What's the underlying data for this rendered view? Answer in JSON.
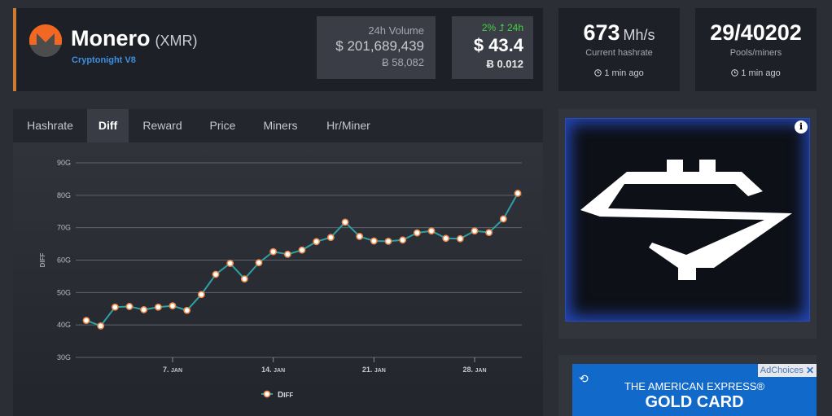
{
  "coin": {
    "name": "Monero",
    "ticker": "(XMR)",
    "algorithm": "Cryptonight V8",
    "accent_color": "#d07a31"
  },
  "volume": {
    "label": "24h Volume",
    "usd": "$ 201,689,439",
    "btc": "Ƀ 58,082"
  },
  "price": {
    "change": "2% ⮥ 24h",
    "change_color": "#41d241",
    "usd": "$ 43.4",
    "btc": "Ƀ 0.012"
  },
  "stats": [
    {
      "value": "673",
      "unit": "Mh/s",
      "label": "Current hashrate",
      "time": "1 min ago",
      "icon": "clock-icon"
    },
    {
      "value": "29/40202",
      "unit": "",
      "label": "Pools/miners",
      "time": "1 min ago",
      "icon": "clock-icon"
    }
  ],
  "tabs": [
    "Hashrate",
    "Diff",
    "Reward",
    "Price",
    "Miners",
    "Hr/Miner"
  ],
  "active_tab": "Diff",
  "chart_data": {
    "type": "line",
    "ylabel": "Diff",
    "xlabel": "",
    "ylim": [
      30,
      90
    ],
    "yticks": [
      "30G",
      "40G",
      "50G",
      "60G",
      "70G",
      "80G",
      "90G"
    ],
    "ytick_values": [
      30,
      40,
      50,
      60,
      70,
      80,
      90
    ],
    "x_tick_labels": [
      "7. Jan",
      "14. Jan",
      "21. Jan",
      "28. Jan"
    ],
    "x_tick_days": [
      7,
      14,
      21,
      28
    ],
    "x": [
      1,
      2,
      3,
      4,
      5,
      6,
      7,
      8,
      9,
      10,
      11,
      12,
      13,
      14,
      15,
      16,
      17,
      18,
      19,
      20,
      21,
      22,
      23,
      24,
      25,
      26,
      27,
      28,
      29,
      30,
      31
    ],
    "series": [
      {
        "name": "Diff",
        "values": [
          41.4,
          39.7,
          45.5,
          45.7,
          44.7,
          45.5,
          45.9,
          44.5,
          49.4,
          55.6,
          59.0,
          54.2,
          59.2,
          62.6,
          61.8,
          63.1,
          65.7,
          67.0,
          71.7,
          67.3,
          65.9,
          65.8,
          66.2,
          68.4,
          69.0,
          66.7,
          66.6,
          69.0,
          68.5,
          72.7,
          80.6
        ]
      }
    ],
    "line_color": "#2fa0a3",
    "marker_color": "#ee8a4b",
    "grid": true,
    "legend_position": "bottom-center"
  },
  "ad2": {
    "top_text": "THE AMERICAN EXPRESS®",
    "main_text": "GOLD CARD",
    "adchoices": "AdChoices",
    "close": "✕"
  },
  "ad1": {
    "info": "i"
  }
}
